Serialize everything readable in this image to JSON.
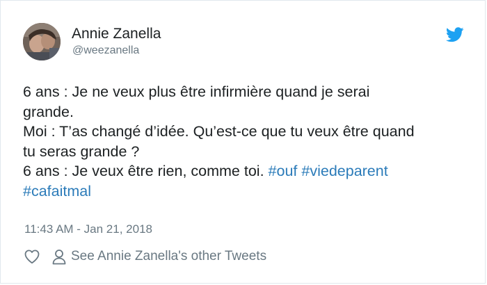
{
  "author": {
    "display_name": "Annie Zanella",
    "screen_name": "@weezanella",
    "avatar_icon": "user-avatar"
  },
  "brand": {
    "icon": "twitter-bird-icon",
    "color": "#1da1f2"
  },
  "tweet": {
    "lines": {
      "l1": "6 ans : Je ne veux plus être infirmière quand je serai",
      "l2": "grande.",
      "l3": "Moi : T’as changé d’idée. Qu’est-ce que tu veux être quand",
      "l4": "tu seras grande ?",
      "l5_text": "6 ans : Je veux être rien, comme toi.",
      "l5_tag1": "#ouf",
      "l5_tag2": "#viedeparent",
      "l6_tag3": "#cafaitmal"
    },
    "hashtag_color": "#2b7bb9",
    "timestamp": "11:43 AM - Jan 21, 2018"
  },
  "actions": {
    "like_icon": "heart-icon",
    "profile_icon": "person-icon",
    "see_more_label": "See Annie Zanella's other Tweets"
  }
}
